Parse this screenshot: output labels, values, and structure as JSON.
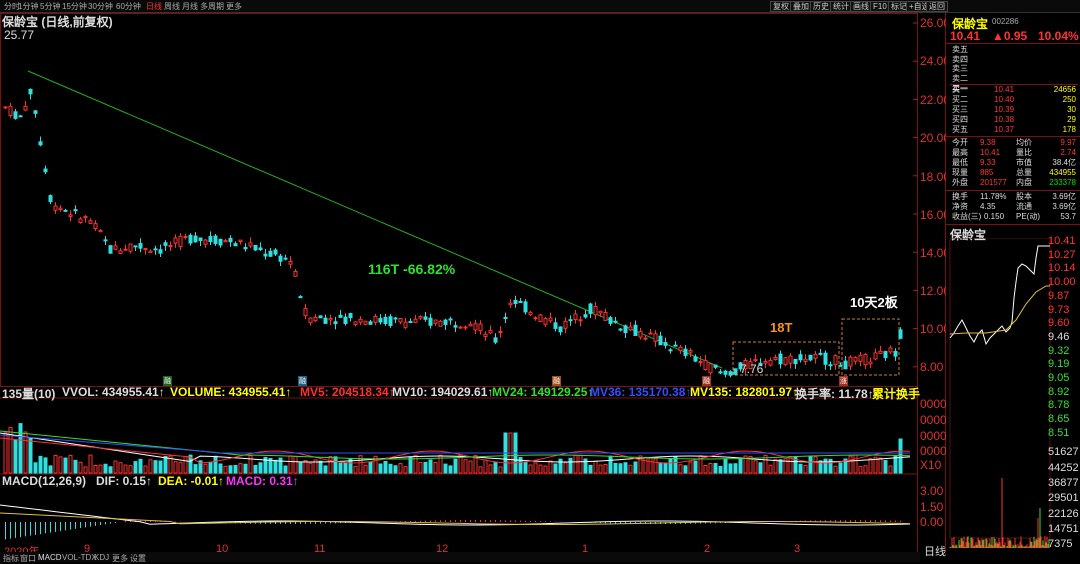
{
  "toolbar": {
    "timeframes": [
      "分时",
      "1分钟",
      "5分钟",
      "15分钟",
      "30分钟",
      "60分钟",
      "日线",
      "周线",
      "月线",
      "多周期",
      "更多"
    ],
    "active_timeframe": "日线",
    "right_buttons": [
      "复权",
      "叠加",
      "历史",
      "统计",
      "画线",
      "F10",
      "标记",
      "+自选",
      "返回"
    ]
  },
  "chart": {
    "title": "保龄宝 (日线,前复权)",
    "high_label": "25.77",
    "low_label": "7.76",
    "annotation_decline": "116T -66.82%",
    "annotation_18t": "18T",
    "annotation_limit": "10天2板",
    "price_axis": [
      "26.00",
      "24.00",
      "22.00",
      "20.00",
      "18.00",
      "16.00",
      "14.00",
      "12.00",
      "10.00",
      "8.00"
    ],
    "volume_axis": [
      "0000",
      "0000",
      "0000",
      "0000",
      "X10"
    ],
    "macd_axis": [
      "3.00",
      "1.50",
      "0.00"
    ],
    "x_labels": [
      "2020年",
      "9",
      "10",
      "11",
      "12",
      "1",
      "2",
      "3"
    ],
    "markers": [
      "融",
      "融",
      "融",
      "融",
      "涨"
    ]
  },
  "volume_legend": {
    "period": "135量(10)",
    "vvol": "VVOL: 434955.41↑",
    "volume": "VOLUME: 434955.41↑",
    "mv5": "MV5: 204518.34↑",
    "mv10": "MV10: 194029.61↑",
    "mv24": "MV24: 149129.25↑",
    "mv36": "MV36: 135170.38↑",
    "mv135": "MV135: 182801.97↑",
    "turnover": "换手率: 11.78↑",
    "cum_turnover": "累计换手"
  },
  "macd_legend": {
    "name": "MACD(12,26,9)",
    "dif": "DIF: 0.15↑",
    "dea": "DEA: -0.01↑",
    "macd": "MACD: 0.31↑"
  },
  "bottom_tabs": [
    "指标",
    "窗口",
    "MACD",
    "VOL-TDX",
    "KDJ",
    "更多",
    "设置"
  ],
  "quote": {
    "name": "保龄宝",
    "code": "002286",
    "price": "10.41",
    "change": "▲0.95",
    "pct": "10.04%",
    "sells": [
      {
        "label": "卖五",
        "price": "",
        "vol": ""
      },
      {
        "label": "卖四",
        "price": "",
        "vol": ""
      },
      {
        "label": "卖三",
        "price": "",
        "vol": ""
      },
      {
        "label": "卖二",
        "price": "",
        "vol": ""
      },
      {
        "label": "卖一",
        "price": "",
        "vol": ""
      }
    ],
    "buys": [
      {
        "label": "买一",
        "price": "10.41",
        "vol": "24656"
      },
      {
        "label": "买二",
        "price": "10.40",
        "vol": "250"
      },
      {
        "label": "买三",
        "price": "10.39",
        "vol": "30"
      },
      {
        "label": "买四",
        "price": "10.38",
        "vol": "29"
      },
      {
        "label": "买五",
        "price": "10.37",
        "vol": "178"
      }
    ],
    "stats": [
      {
        "l1": "今开",
        "v1": "9.38",
        "l2": "均价",
        "v2": "9.97"
      },
      {
        "l1": "最高",
        "v1": "10.41",
        "l2": "量比",
        "v2": "2.74"
      },
      {
        "l1": "最低",
        "v1": "9.33",
        "l2": "市值",
        "v2": "38.4亿"
      },
      {
        "l1": "现量",
        "v1": "885",
        "l2": "总量",
        "v2": "434955"
      },
      {
        "l1": "外盘",
        "v1": "201577",
        "l2": "内盘",
        "v2": "233378"
      }
    ],
    "stats2": [
      {
        "l1": "换手",
        "v1": "11.78%",
        "l2": "股本",
        "v2": "3.69亿"
      },
      {
        "l1": "净资",
        "v1": "4.35",
        "l2": "流通",
        "v2": "3.69亿"
      },
      {
        "l1": "收益(三)",
        "v1": "0.150",
        "l2": "PE(动)",
        "v2": "53.7"
      }
    ],
    "mini_title": "保龄宝",
    "mini_axis": [
      "10.41",
      "10.27",
      "10.14",
      "10.00",
      "9.87",
      "9.73",
      "9.60",
      "9.46",
      "9.32",
      "9.19",
      "9.05",
      "8.92",
      "8.78",
      "8.65",
      "8.51"
    ],
    "mini_vol_axis": [
      "51627",
      "44252",
      "36877",
      "29501",
      "22126",
      "14751",
      "7375"
    ],
    "bottom_label": "日线"
  }
}
